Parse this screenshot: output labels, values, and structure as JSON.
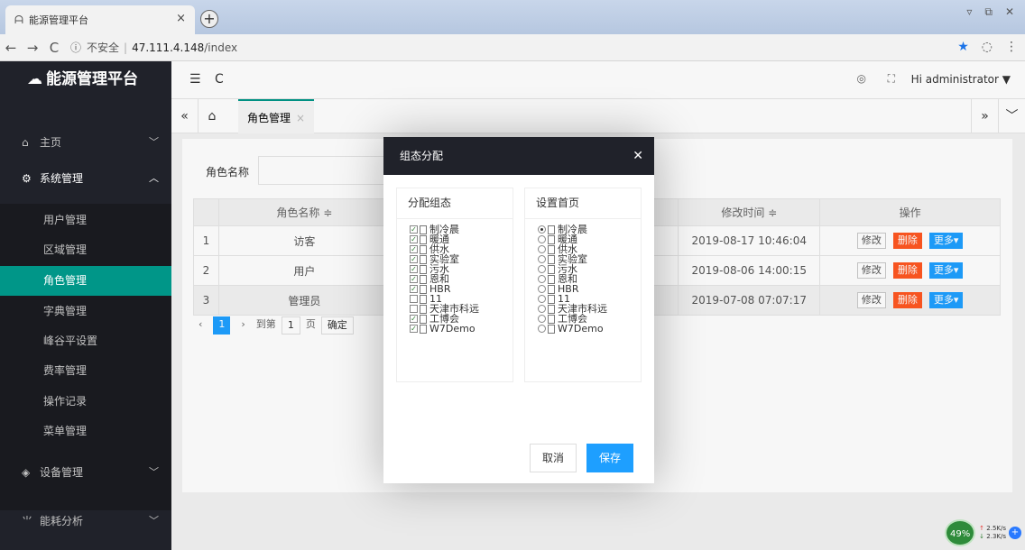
{
  "browser": {
    "tab_title": "能源管理平台",
    "tab_close": "×",
    "new_tab": "+",
    "security": "不安全",
    "url_host": "47.111.4.148",
    "url_path": "/index"
  },
  "sidebar": {
    "logo": "能源管理平台",
    "home": "主页",
    "system": "系统管理",
    "sub_items": [
      "用户管理",
      "区域管理",
      "角色管理",
      "字典管理",
      "峰谷平设置",
      "费率管理",
      "操作记录",
      "菜单管理"
    ],
    "active_sub": "角色管理",
    "device": "设备管理",
    "energy": "能耗分析"
  },
  "header": {
    "user": "Hi administrator"
  },
  "pagetabs": {
    "current": "角色管理",
    "close": "×"
  },
  "search": {
    "label": "角色名称"
  },
  "table": {
    "headers": [
      "",
      "角色名称 ≑",
      "修改时间 ≑",
      "操作"
    ],
    "rows": [
      {
        "no": "1",
        "name": "访客",
        "time": "2019-08-17 10:46:04"
      },
      {
        "no": "2",
        "name": "用户",
        "time": "2019-08-06 14:00:15"
      },
      {
        "no": "3",
        "name": "管理员",
        "time": "2019-07-08 07:07:17"
      }
    ],
    "edit": "修改",
    "del": "删除",
    "more": "更多▾"
  },
  "pager": {
    "page": "1",
    "goto": "到第",
    "page_input": "1",
    "unit": "页",
    "confirm": "确定"
  },
  "modal": {
    "title": "组态分配",
    "left_title": "分配组态",
    "right_title": "设置首页",
    "items": [
      {
        "label": "制冷晨",
        "checked": true
      },
      {
        "label": "暖通",
        "checked": true
      },
      {
        "label": "供水",
        "checked": true
      },
      {
        "label": "实验室",
        "checked": true
      },
      {
        "label": "污水",
        "checked": true
      },
      {
        "label": "恩和",
        "checked": true
      },
      {
        "label": "HBR",
        "checked": true
      },
      {
        "label": "11",
        "checked": false
      },
      {
        "label": "天津市科远",
        "checked": false
      },
      {
        "label": "工博会",
        "checked": true
      },
      {
        "label": "W7Demo",
        "checked": true
      }
    ],
    "home_selected": "制冷晨",
    "cancel": "取消",
    "save": "保存"
  },
  "net": {
    "percent": "49%",
    "up": "2.5K/s",
    "down": "2.3K/s"
  },
  "colors": {
    "accent": "#009688",
    "blue": "#1e9fff",
    "danger": "#ff5722",
    "dark": "#20222a"
  }
}
